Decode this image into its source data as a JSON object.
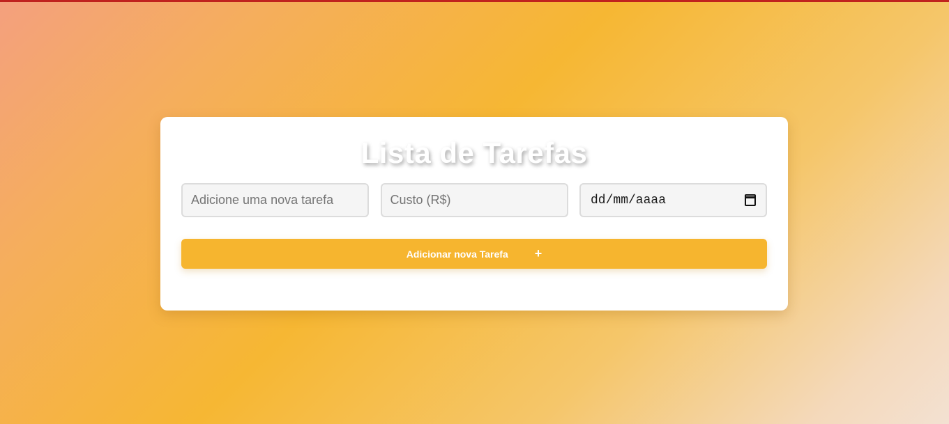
{
  "app": {
    "title": "Lista de Tarefas"
  },
  "form": {
    "task_placeholder": "Adicione uma nova tarefa",
    "cost_placeholder": "Custo (R$)",
    "date_placeholder": "dd/mm/aaaa",
    "add_button_label": "Adicionar nova Tarefa",
    "add_button_icon": "+"
  },
  "colors": {
    "accent": "#f6b52f",
    "top_bar": "#c0221e",
    "card_background": "#ffffff"
  },
  "icons": {
    "date_picker": "calendar-icon",
    "add": "plus-icon"
  }
}
